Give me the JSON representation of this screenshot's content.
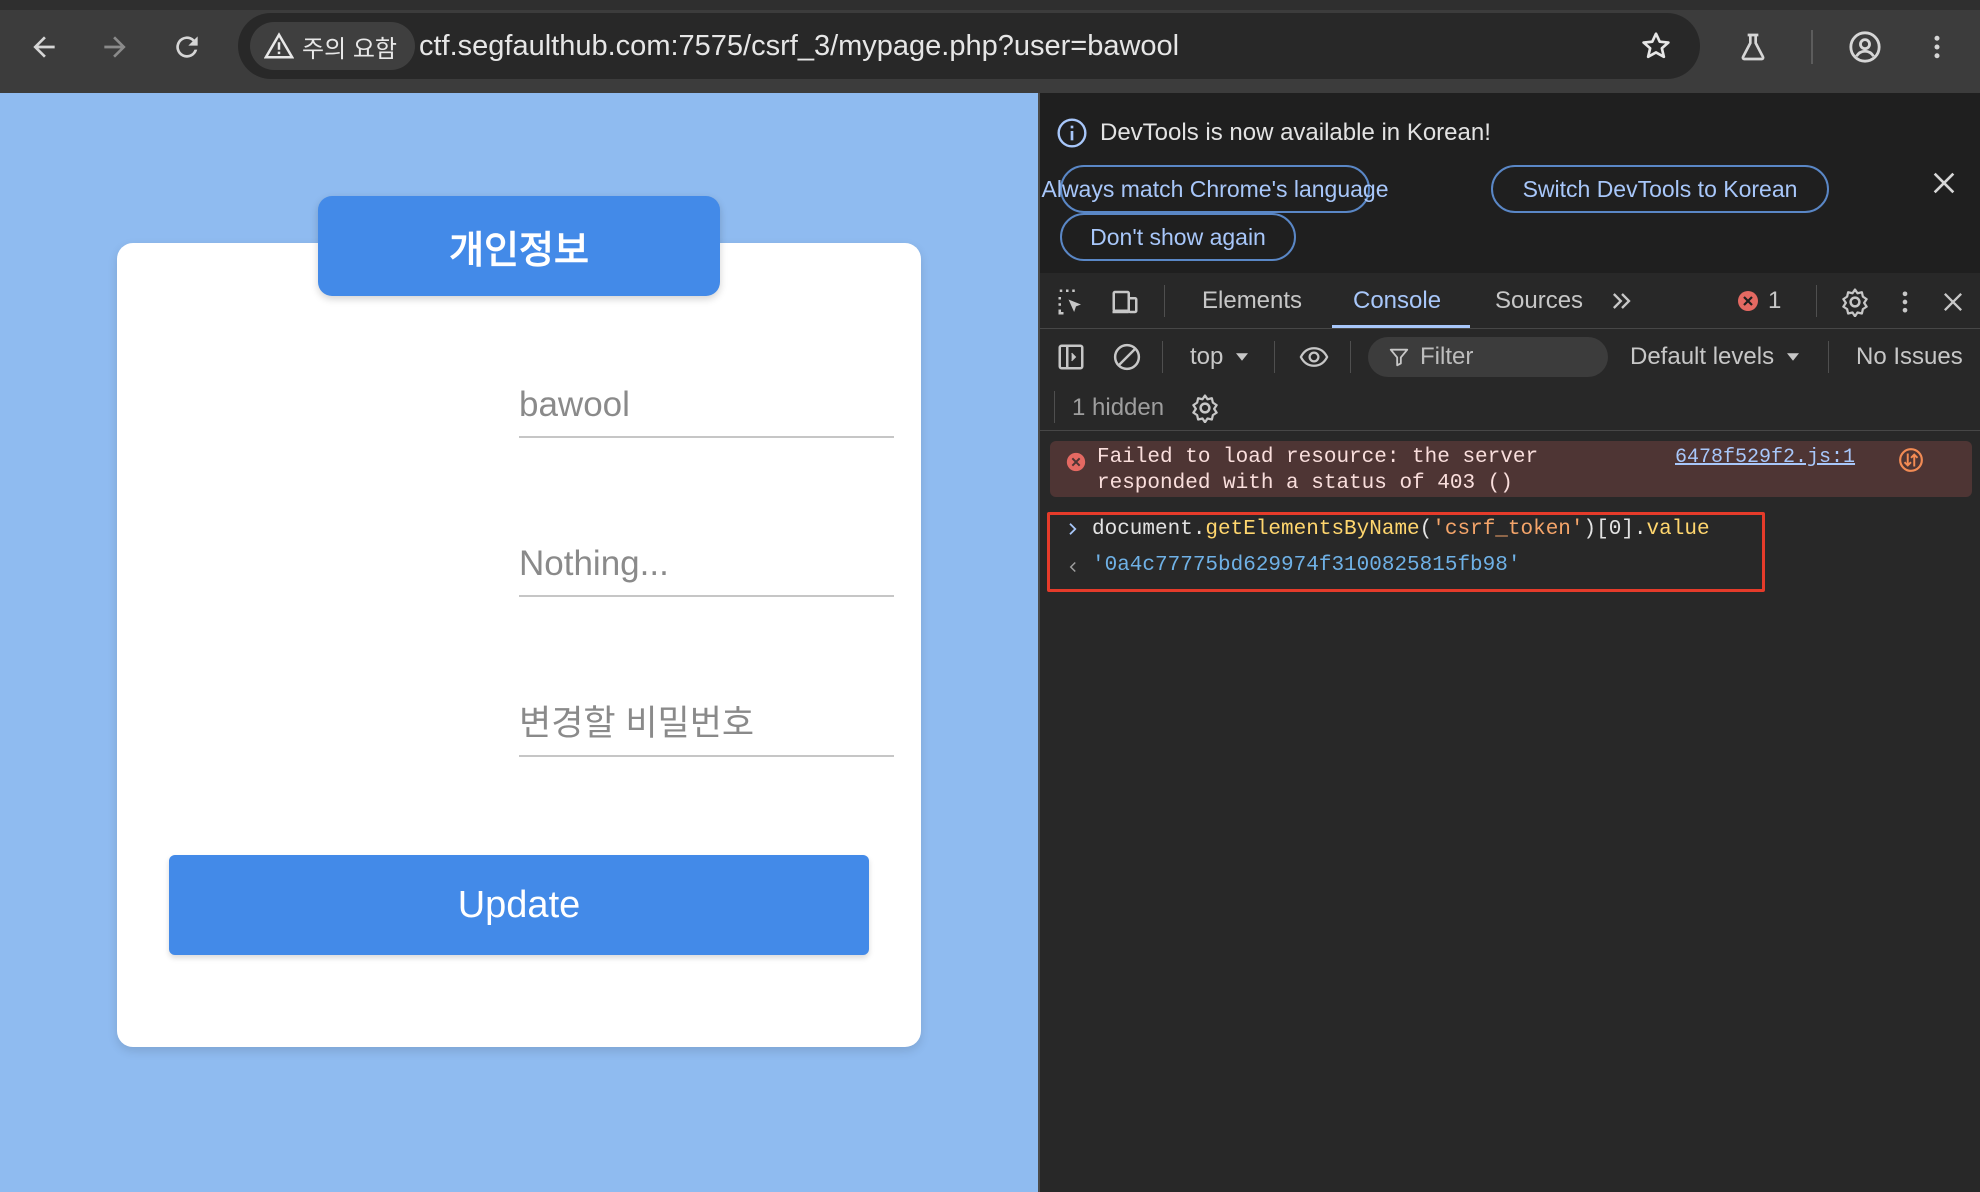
{
  "browser": {
    "security_chip": "주의 요함",
    "url": "ctf.segfaulthub.com:7575/csrf_3/mypage.php?user=bawool"
  },
  "page": {
    "title": "개인정보",
    "username_value": "bawool",
    "info_placeholder": "Nothing...",
    "password_placeholder": "변경할 비밀번호",
    "update_label": "Update"
  },
  "devtools": {
    "infobar": {
      "message": "DevTools is now available in Korean!",
      "btn_match": "Always match Chrome's language",
      "btn_switch": "Switch DevTools to Korean",
      "btn_dont_show": "Don't show again"
    },
    "tabs": [
      "Elements",
      "Console",
      "Sources"
    ],
    "active_tab": "Console",
    "error_count": "1",
    "toolbar": {
      "context": "top",
      "filter_placeholder": "Filter",
      "levels": "Default levels",
      "issues": "No Issues",
      "hidden": "1 hidden"
    },
    "console": {
      "error_line1": "Failed to load resource: the server",
      "error_line2": "responded with a status of 403 ()",
      "error_source": "6478f529f2.js:1",
      "command": {
        "obj": "document.",
        "method": "getElementsByName",
        "open": "(",
        "arg": "'csrf_token'",
        "close_idx": ")[0].",
        "prop": "value"
      },
      "result": "'0a4c77775bd629974f3100825815fb98'"
    }
  },
  "colors": {
    "page_bg": "#8fbbf0",
    "accent_blue": "#438ae8",
    "devtools_bg": "#282828",
    "error_bg": "#4e3534",
    "highlight_box": "#e53b2a"
  }
}
